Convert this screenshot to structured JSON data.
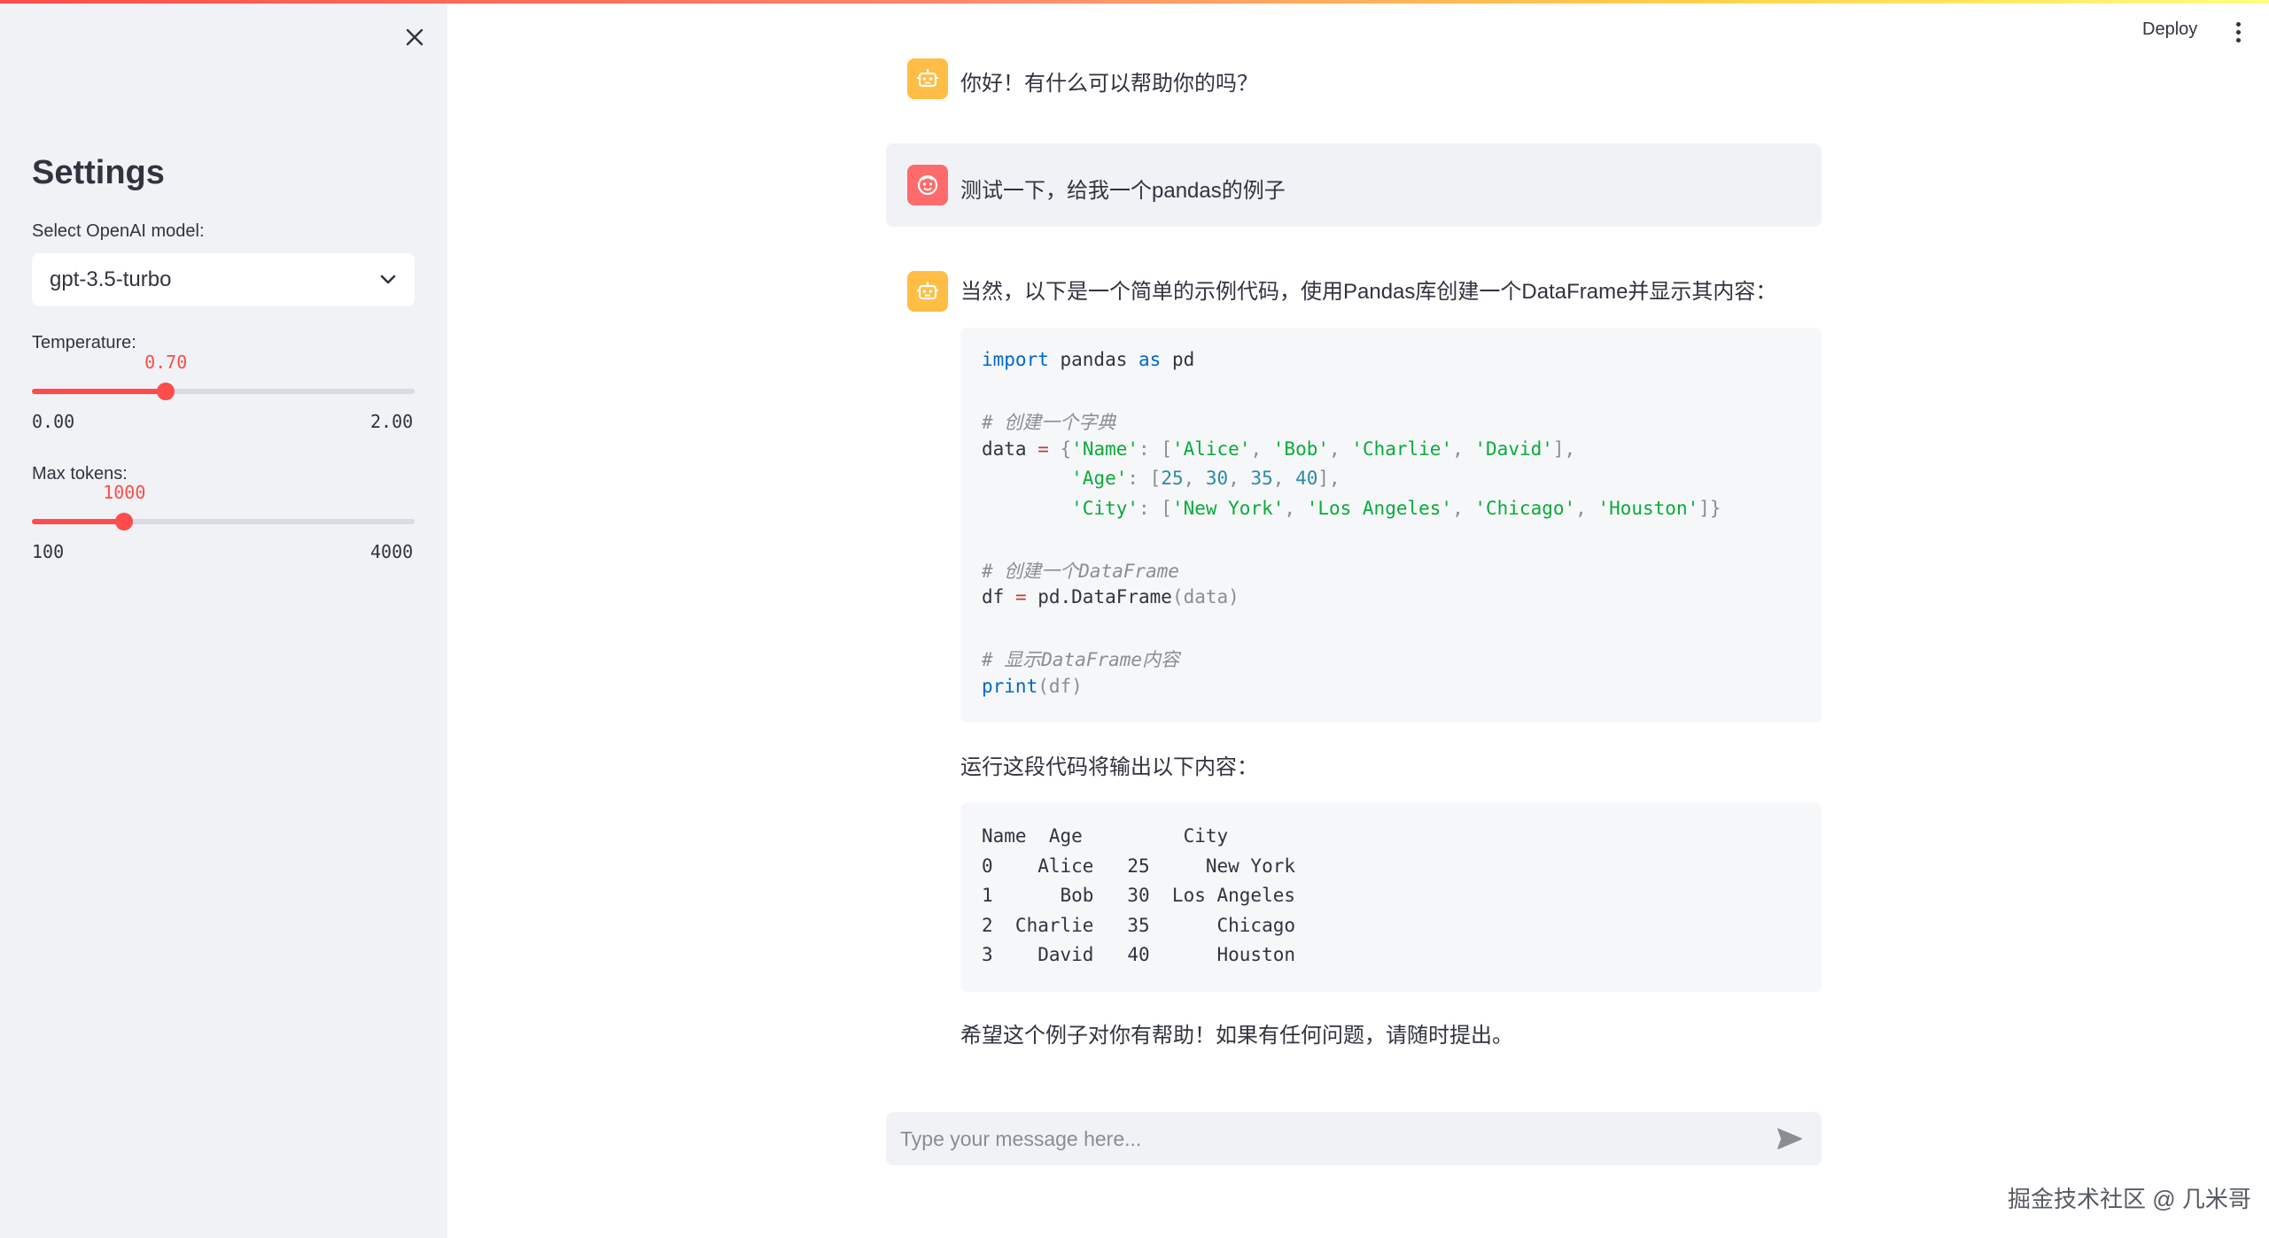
{
  "sidebar": {
    "title": "Settings",
    "model_label": "Select OpenAI model:",
    "model_value": "gpt-3.5-turbo",
    "temperature": {
      "label": "Temperature:",
      "value": "0.70",
      "min": "0.00",
      "max": "2.00",
      "fraction": 0.35
    },
    "max_tokens": {
      "label": "Max tokens:",
      "value": "1000",
      "min": "100",
      "max": "4000",
      "fraction": 0.2414
    }
  },
  "header": {
    "deploy_label": "Deploy"
  },
  "chat": {
    "greeting": "你好！有什么可以帮助你的吗？",
    "user_message": "测试一下，给我一个pandas的例子",
    "assistant_intro": "当然，以下是一个简单的示例代码，使用Pandas库创建一个DataFrame并显示其内容：",
    "code": {
      "import_kw": "import",
      "import_mod": " pandas ",
      "as_kw": "as",
      "alias": " pd",
      "comment1": "# 创建一个字典",
      "data_var": "data ",
      "data_eq": "=",
      "data_open": " {",
      "key_name": "'Name'",
      "names": [
        "'Alice'",
        "'Bob'",
        "'Charlie'",
        "'David'"
      ],
      "key_age": "'Age'",
      "ages": [
        "25",
        "30",
        "35",
        "40"
      ],
      "key_city": "'City'",
      "cities": [
        "'New York'",
        "'Los Angeles'",
        "'Chicago'",
        "'Houston'"
      ],
      "comment2": "# 创建一个DataFrame",
      "df_line_var": "df ",
      "df_line_eq": "=",
      "df_line_rest": " pd.DataFrame",
      "df_args": "(data)",
      "comment3": "# 显示DataFrame内容",
      "print_kw": "print",
      "print_args": "(df)"
    },
    "output_intro": "运行这段代码将输出以下内容：",
    "output_lines": [
      "Name  Age         City",
      "0    Alice   25     New York",
      "1      Bob   30  Los Angeles",
      "2  Charlie   35      Chicago",
      "3    David   40      Houston"
    ],
    "closing": "希望这个例子对你有帮助！如果有任何问题，请随时提出。"
  },
  "input": {
    "placeholder": "Type your message here..."
  },
  "watermark": "掘金技术社区 @ 几米哥",
  "colors": {
    "accent": "#ff4b4b",
    "bot_avatar": "#ffbd45",
    "user_avatar": "#ff6b6b"
  }
}
